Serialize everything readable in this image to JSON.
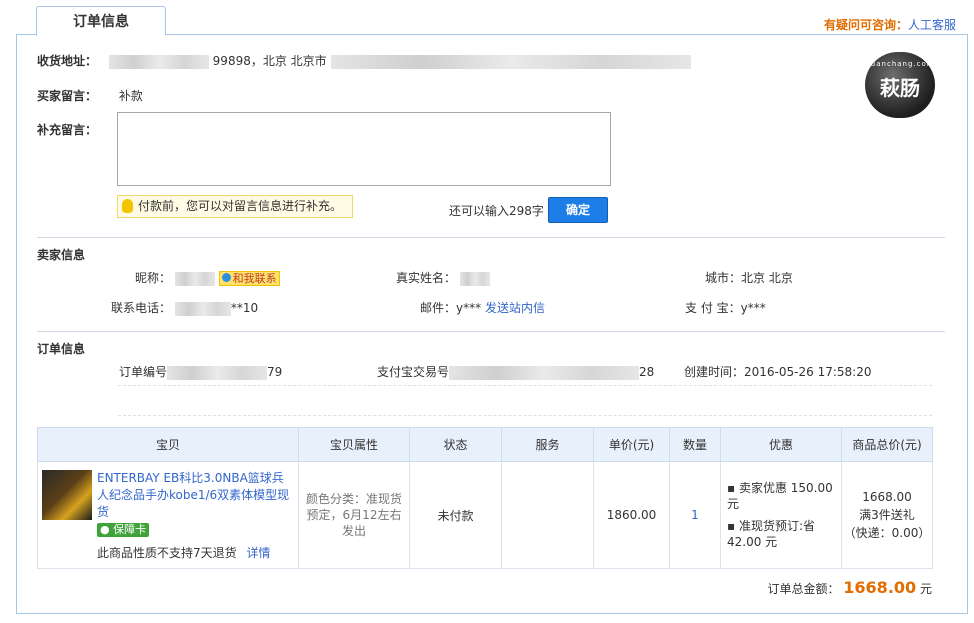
{
  "header": {
    "tab_label": "订单信息",
    "help_prefix": "有疑问可咨询：",
    "help_link": "人工客服"
  },
  "logo": {
    "text_main": "萩肠",
    "text_arc": "huanchang.com"
  },
  "address": {
    "label": "收货地址：",
    "value_visible": "99898，北京 北京市"
  },
  "buyer_msg": {
    "label": "买家留言：",
    "value": "补款"
  },
  "supplement": {
    "label": "补充留言：",
    "tip": "付款前，您可以对留言信息进行补充。",
    "counter": "还可以输入298字",
    "confirm": "确定"
  },
  "seller": {
    "heading": "卖家信息",
    "nickname_label": "昵称：",
    "contact_badge": "和我联系",
    "realname_label": "真实姓名：",
    "city_label": "城市：",
    "city_value": "北京 北京",
    "phone_label": "联系电话：",
    "phone_value": "**10",
    "email_label": "邮件：",
    "email_value": "y***",
    "send_msg_link": "发送站内信",
    "alipay_label": "支 付 宝：",
    "alipay_value": "y***"
  },
  "order": {
    "heading": "订单信息",
    "number_label": "订单编号",
    "number_suffix": "79",
    "alipay_trade_label": "支付宝交易号",
    "alipay_trade_suffix": "28",
    "created_label": "创建时间：",
    "created_value": "2016-05-26 17:58:20"
  },
  "table": {
    "headers": [
      "宝贝",
      "宝贝属性",
      "状态",
      "服务",
      "单价(元)",
      "数量",
      "优惠",
      "商品总价(元)"
    ],
    "row": {
      "title": "ENTERBAY EB科比3.0NBA篮球兵人纪念品手办kobe1/6双素体模型现货",
      "guarantee": "保障卡",
      "no_return": "此商品性质不支持7天退货",
      "detail_link": "详情",
      "attributes": "颜色分类：准现货预定，6月12左右发出",
      "status": "未付款",
      "service": "",
      "unit_price": "1860.00",
      "quantity": "1",
      "discount_1": "卖家优惠 150.00 元",
      "discount_2": "准现货预订:省 42.00 元",
      "total": "1668.00",
      "promo": "满3件送礼",
      "shipping": "（快递：0.00）"
    }
  },
  "summary": {
    "label": "订单总金额：",
    "amount": "1668.00",
    "unit": "元"
  },
  "colors": {
    "accent": "#1c7ee6",
    "price": "#e26d00",
    "border": "#a9c6e8"
  }
}
